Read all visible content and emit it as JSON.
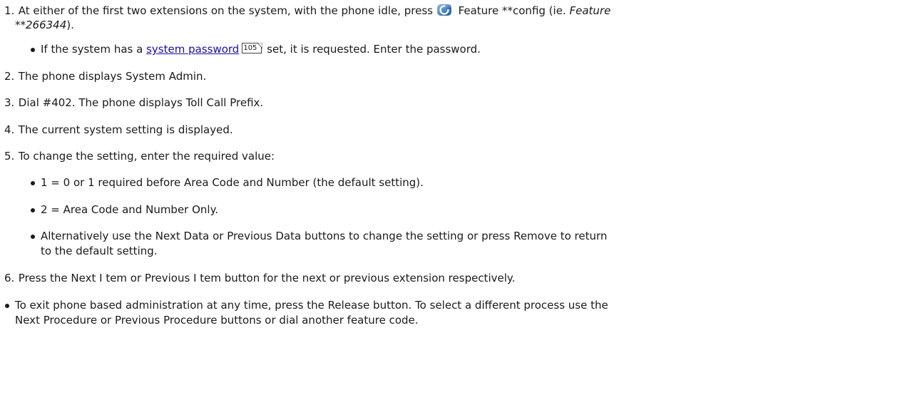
{
  "steps": {
    "s1": {
      "num": "1.",
      "t1": "At either of the first two extensions on the system, with the phone idle, press",
      "t2": "Feature **config (ie.",
      "t3": "Feature",
      "t4": "**266344",
      "t5": ").",
      "icon": "feature-key-icon"
    },
    "s1b": {
      "t1": "If the system has a",
      "link": "system password",
      "ref": "105",
      "t2": "set, it is requested. Enter the password."
    },
    "s2": {
      "num": "2.",
      "text": "The phone displays System Admin."
    },
    "s3": {
      "num": "3.",
      "text": "Dial #402. The phone displays Toll Call Prefix."
    },
    "s4": {
      "num": "4.",
      "text": "The current system setting is displayed."
    },
    "s5": {
      "num": "5.",
      "text": "To change the setting, enter the required value:",
      "b1": "1 = 0 or 1 required before Area Code and Number (the default setting).",
      "b2": "2 = Area Code and Number Only.",
      "b3a": "Alternatively use the Next Data or Previous Data buttons to change the setting or press Remove to return",
      "b3b": "to the default setting."
    },
    "s6": {
      "num": "6.",
      "text": "Press the Next I tem or Previous I tem button for the next or previous extension respectively."
    }
  },
  "final": {
    "l1": "To exit phone based administration at any time, press the Release button. To select a different process use the",
    "l2": "Next Procedure or Previous Procedure buttons or dial another feature code."
  },
  "colors": {
    "text": "#1a1a1a",
    "link": "#1a0dab",
    "icon": "#2b6cb0"
  }
}
